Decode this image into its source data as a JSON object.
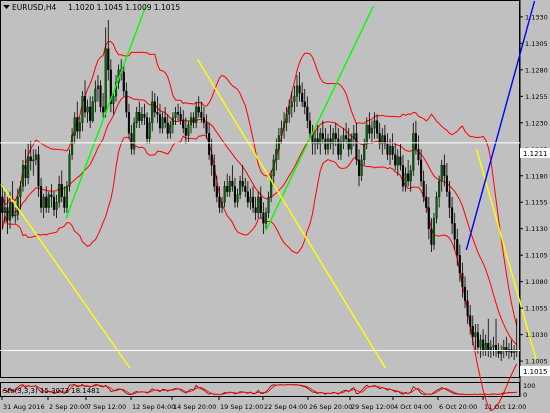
{
  "header": {
    "symbol": "EURUSD,H4",
    "ohlc": "1.1020 1.1045 1.1009 1.1015"
  },
  "sub_window": {
    "label": "Sto(3,3,3) 15.3073 18.1481",
    "ticks": [
      "100",
      "0"
    ]
  },
  "price_labels": {
    "hline": "1.1211",
    "bid": "1.1015"
  },
  "colors": {
    "background": "#c0c0c0",
    "bull_candle": "#006400",
    "bear_candle": "#000000",
    "bands": "#ff0000",
    "trend_up": "#00ff00",
    "trend_down": "#ffff00",
    "trend_blue": "#0000ff",
    "hline": "#ffffff",
    "oscillator": "#8b0000"
  },
  "chart_data": {
    "type": "candlestick",
    "symbol": "EURUSD",
    "timeframe": "H4",
    "ylim": [
      1.099,
      1.1345
    ],
    "y_ticks": [
      "1.1005",
      "1.1030",
      "1.1055",
      "1.1080",
      "1.1105",
      "1.1130",
      "1.1155",
      "1.1180",
      "1.1205",
      "1.1230",
      "1.1255",
      "1.1280",
      "1.1305",
      "1.1330"
    ],
    "x_ticks": [
      "31 Aug 2016",
      "2 Sep 20:00",
      "7 Sep 12:00",
      "12 Sep 04:00",
      "14 Sep 20:00",
      "19 Sep 12:00",
      "22 Sep 04:00",
      "26 Sep 20:00",
      "29 Sep 12:00",
      "4 Oct 04:00",
      "6 Oct 20:00",
      "11 Oct 12:00"
    ],
    "x_count": 210,
    "hline_level": 1.1211,
    "bid_level": 1.1015,
    "candles": [
      [
        1.116,
        1.1172,
        1.113,
        1.1145
      ],
      [
        1.1145,
        1.1165,
        1.1135,
        1.115
      ],
      [
        1.115,
        1.116,
        1.1125,
        1.1138
      ],
      [
        1.1138,
        1.1165,
        1.113,
        1.1155
      ],
      [
        1.1155,
        1.1175,
        1.114,
        1.1142
      ],
      [
        1.1142,
        1.115,
        1.1135,
        1.1143
      ],
      [
        1.1143,
        1.1168,
        1.1138,
        1.116
      ],
      [
        1.116,
        1.1175,
        1.1148,
        1.117
      ],
      [
        1.117,
        1.1195,
        1.1165,
        1.119
      ],
      [
        1.119,
        1.1205,
        1.117,
        1.1178
      ],
      [
        1.1178,
        1.121,
        1.1172,
        1.1198
      ],
      [
        1.1198,
        1.1213,
        1.1185,
        1.1194
      ],
      [
        1.1194,
        1.1205,
        1.118,
        1.1195
      ],
      [
        1.1195,
        1.1205,
        1.119,
        1.12
      ],
      [
        1.12,
        1.1208,
        1.116,
        1.117
      ],
      [
        1.117,
        1.1178,
        1.1145,
        1.115
      ],
      [
        1.115,
        1.1163,
        1.114,
        1.116
      ],
      [
        1.116,
        1.117,
        1.1145,
        1.115
      ],
      [
        1.115,
        1.1165,
        1.1145,
        1.1162
      ],
      [
        1.1162,
        1.1172,
        1.115,
        1.116
      ],
      [
        1.116,
        1.1165,
        1.1142,
        1.1148
      ],
      [
        1.1148,
        1.1162,
        1.114,
        1.1155
      ],
      [
        1.1155,
        1.118,
        1.115,
        1.1172
      ],
      [
        1.1172,
        1.1185,
        1.1155,
        1.116
      ],
      [
        1.116,
        1.117,
        1.1145,
        1.115
      ],
      [
        1.115,
        1.1175,
        1.1145,
        1.117
      ],
      [
        1.117,
        1.1205,
        1.1165,
        1.12
      ],
      [
        1.12,
        1.1225,
        1.1195,
        1.1218
      ],
      [
        1.1218,
        1.124,
        1.121,
        1.1235
      ],
      [
        1.1235,
        1.125,
        1.1215,
        1.1222
      ],
      [
        1.1222,
        1.1235,
        1.1215,
        1.123
      ],
      [
        1.123,
        1.126,
        1.1222,
        1.1255
      ],
      [
        1.1255,
        1.127,
        1.1235,
        1.124
      ],
      [
        1.124,
        1.1252,
        1.123,
        1.1245
      ],
      [
        1.1245,
        1.1255,
        1.1225,
        1.1232
      ],
      [
        1.1232,
        1.1255,
        1.123,
        1.125
      ],
      [
        1.125,
        1.127,
        1.124,
        1.1262
      ],
      [
        1.1262,
        1.1275,
        1.125,
        1.1265
      ],
      [
        1.1265,
        1.127,
        1.124,
        1.1245
      ],
      [
        1.1245,
        1.1258,
        1.1235,
        1.124
      ],
      [
        1.124,
        1.132,
        1.1235,
        1.13
      ],
      [
        1.13,
        1.1327,
        1.127,
        1.128
      ],
      [
        1.128,
        1.129,
        1.124,
        1.1248
      ],
      [
        1.1248,
        1.126,
        1.1238,
        1.1255
      ],
      [
        1.1255,
        1.1275,
        1.125,
        1.1268
      ],
      [
        1.1268,
        1.1285,
        1.1262,
        1.128
      ],
      [
        1.128,
        1.129,
        1.127,
        1.1278
      ],
      [
        1.1278,
        1.1285,
        1.1255,
        1.126
      ],
      [
        1.126,
        1.1268,
        1.1235,
        1.124
      ],
      [
        1.124,
        1.1248,
        1.1215,
        1.122
      ],
      [
        1.122,
        1.1228,
        1.12,
        1.1205
      ],
      [
        1.1205,
        1.1235,
        1.12,
        1.123
      ],
      [
        1.123,
        1.1245,
        1.1225,
        1.124
      ],
      [
        1.124,
        1.125,
        1.1225,
        1.1232
      ],
      [
        1.1232,
        1.1245,
        1.1228,
        1.1238
      ],
      [
        1.1238,
        1.1248,
        1.1228,
        1.1235
      ],
      [
        1.1235,
        1.124,
        1.121,
        1.1215
      ],
      [
        1.1215,
        1.1235,
        1.121,
        1.123
      ],
      [
        1.123,
        1.126,
        1.1222,
        1.125
      ],
      [
        1.125,
        1.1258,
        1.1235,
        1.124
      ],
      [
        1.124,
        1.1255,
        1.123,
        1.1238
      ],
      [
        1.1238,
        1.1248,
        1.122,
        1.1225
      ],
      [
        1.1225,
        1.124,
        1.122,
        1.1235
      ],
      [
        1.1235,
        1.1245,
        1.1225,
        1.123
      ],
      [
        1.123,
        1.1238,
        1.1215,
        1.122
      ],
      [
        1.122,
        1.1232,
        1.1215,
        1.1228
      ],
      [
        1.1228,
        1.124,
        1.122,
        1.1235
      ],
      [
        1.1235,
        1.1245,
        1.1228,
        1.124
      ],
      [
        1.124,
        1.1248,
        1.1232,
        1.1238
      ],
      [
        1.1238,
        1.1245,
        1.1228,
        1.1232
      ],
      [
        1.1232,
        1.1242,
        1.122,
        1.1225
      ],
      [
        1.1225,
        1.1235,
        1.121,
        1.1218
      ],
      [
        1.1218,
        1.1232,
        1.1212,
        1.1228
      ],
      [
        1.1228,
        1.124,
        1.122,
        1.1235
      ],
      [
        1.1235,
        1.124,
        1.1225,
        1.123
      ],
      [
        1.123,
        1.125,
        1.1225,
        1.1245
      ],
      [
        1.1245,
        1.1255,
        1.1235,
        1.124
      ],
      [
        1.124,
        1.125,
        1.123,
        1.1235
      ],
      [
        1.1235,
        1.1245,
        1.1225,
        1.123
      ],
      [
        1.123,
        1.1238,
        1.1215,
        1.122
      ],
      [
        1.122,
        1.123,
        1.1195,
        1.12
      ],
      [
        1.12,
        1.1215,
        1.118,
        1.119
      ],
      [
        1.119,
        1.12,
        1.1165,
        1.117
      ],
      [
        1.117,
        1.118,
        1.1155,
        1.116
      ],
      [
        1.116,
        1.117,
        1.1145,
        1.115
      ],
      [
        1.115,
        1.116,
        1.1145,
        1.1155
      ],
      [
        1.1155,
        1.1175,
        1.115,
        1.117
      ],
      [
        1.117,
        1.1182,
        1.116,
        1.1165
      ],
      [
        1.1165,
        1.118,
        1.116,
        1.1175
      ],
      [
        1.1175,
        1.119,
        1.1165,
        1.117
      ],
      [
        1.117,
        1.1178,
        1.115,
        1.1155
      ],
      [
        1.1155,
        1.1168,
        1.115,
        1.1162
      ],
      [
        1.1162,
        1.118,
        1.1158,
        1.1175
      ],
      [
        1.1175,
        1.119,
        1.1165,
        1.117
      ],
      [
        1.117,
        1.1178,
        1.116,
        1.1165
      ],
      [
        1.1165,
        1.1175,
        1.115,
        1.1155
      ],
      [
        1.1155,
        1.1168,
        1.1148,
        1.116
      ],
      [
        1.116,
        1.117,
        1.1145,
        1.115
      ],
      [
        1.115,
        1.116,
        1.1138,
        1.1145
      ],
      [
        1.1145,
        1.1165,
        1.114,
        1.116
      ],
      [
        1.116,
        1.117,
        1.114,
        1.1145
      ],
      [
        1.1145,
        1.1155,
        1.1125,
        1.1135
      ],
      [
        1.1135,
        1.115,
        1.113,
        1.1145
      ],
      [
        1.1145,
        1.1165,
        1.114,
        1.116
      ],
      [
        1.116,
        1.1185,
        1.1155,
        1.118
      ],
      [
        1.118,
        1.12,
        1.117,
        1.1195
      ],
      [
        1.1195,
        1.1215,
        1.1185,
        1.1205
      ],
      [
        1.1205,
        1.1225,
        1.1195,
        1.1218
      ],
      [
        1.1218,
        1.1232,
        1.121,
        1.1225
      ],
      [
        1.1225,
        1.124,
        1.1215,
        1.123
      ],
      [
        1.123,
        1.1245,
        1.1222,
        1.1238
      ],
      [
        1.1238,
        1.1252,
        1.123,
        1.1245
      ],
      [
        1.1245,
        1.126,
        1.1235,
        1.125
      ],
      [
        1.125,
        1.1265,
        1.124,
        1.1255
      ],
      [
        1.1255,
        1.1275,
        1.1245,
        1.1265
      ],
      [
        1.1265,
        1.1278,
        1.125,
        1.1258
      ],
      [
        1.1258,
        1.1268,
        1.1245,
        1.125
      ],
      [
        1.125,
        1.1262,
        1.1238,
        1.1245
      ],
      [
        1.1245,
        1.1255,
        1.1225,
        1.1232
      ],
      [
        1.1232,
        1.124,
        1.1215,
        1.122
      ],
      [
        1.122,
        1.1228,
        1.12,
        1.121
      ],
      [
        1.121,
        1.1222,
        1.12,
        1.1215
      ],
      [
        1.1215,
        1.1228,
        1.1205,
        1.121
      ],
      [
        1.121,
        1.1225,
        1.12,
        1.122
      ],
      [
        1.122,
        1.1232,
        1.121,
        1.1215
      ],
      [
        1.1215,
        1.1225,
        1.12,
        1.1205
      ],
      [
        1.1205,
        1.122,
        1.12,
        1.1215
      ],
      [
        1.1215,
        1.1228,
        1.1205,
        1.121
      ],
      [
        1.121,
        1.1225,
        1.12,
        1.122
      ],
      [
        1.122,
        1.123,
        1.1208,
        1.1215
      ],
      [
        1.1215,
        1.1225,
        1.1195,
        1.12
      ],
      [
        1.12,
        1.1218,
        1.1195,
        1.1212
      ],
      [
        1.1212,
        1.1225,
        1.1205,
        1.1218
      ],
      [
        1.1218,
        1.123,
        1.121,
        1.1215
      ],
      [
        1.1215,
        1.1225,
        1.1198,
        1.1205
      ],
      [
        1.1205,
        1.122,
        1.12,
        1.1215
      ],
      [
        1.1215,
        1.1228,
        1.1208,
        1.122
      ],
      [
        1.122,
        1.123,
        1.119,
        1.1195
      ],
      [
        1.1195,
        1.1205,
        1.117,
        1.118
      ],
      [
        1.118,
        1.12,
        1.1175,
        1.1195
      ],
      [
        1.1195,
        1.1215,
        1.119,
        1.121
      ],
      [
        1.121,
        1.1235,
        1.1205,
        1.1228
      ],
      [
        1.1228,
        1.124,
        1.1215,
        1.122
      ],
      [
        1.122,
        1.1232,
        1.121,
        1.1225
      ],
      [
        1.1225,
        1.124,
        1.1215,
        1.1232
      ],
      [
        1.1232,
        1.1238,
        1.1215,
        1.122
      ],
      [
        1.122,
        1.123,
        1.1205,
        1.121
      ],
      [
        1.121,
        1.1225,
        1.12,
        1.1218
      ],
      [
        1.1218,
        1.1228,
        1.1205,
        1.121
      ],
      [
        1.121,
        1.122,
        1.1195,
        1.12
      ],
      [
        1.12,
        1.1215,
        1.119,
        1.1208
      ],
      [
        1.1208,
        1.122,
        1.1195,
        1.12
      ],
      [
        1.12,
        1.1212,
        1.1185,
        1.119
      ],
      [
        1.119,
        1.1205,
        1.118,
        1.1198
      ],
      [
        1.1198,
        1.121,
        1.1185,
        1.119
      ],
      [
        1.119,
        1.12,
        1.1165,
        1.117
      ],
      [
        1.117,
        1.1188,
        1.1165,
        1.1182
      ],
      [
        1.1182,
        1.1195,
        1.117,
        1.1175
      ],
      [
        1.1175,
        1.119,
        1.1165,
        1.1185
      ],
      [
        1.1185,
        1.123,
        1.118,
        1.122
      ],
      [
        1.122,
        1.1232,
        1.12,
        1.1205
      ],
      [
        1.1205,
        1.1218,
        1.119,
        1.1195
      ],
      [
        1.1195,
        1.1205,
        1.117,
        1.1175
      ],
      [
        1.1175,
        1.1185,
        1.1155,
        1.116
      ],
      [
        1.116,
        1.1172,
        1.1145,
        1.115
      ],
      [
        1.115,
        1.116,
        1.112,
        1.113
      ],
      [
        1.113,
        1.114,
        1.1108,
        1.1115
      ],
      [
        1.1115,
        1.1145,
        1.111,
        1.114
      ],
      [
        1.114,
        1.1165,
        1.1135,
        1.116
      ],
      [
        1.116,
        1.118,
        1.115,
        1.1175
      ],
      [
        1.1175,
        1.1195,
        1.1165,
        1.119
      ],
      [
        1.119,
        1.12,
        1.117,
        1.118
      ],
      [
        1.118,
        1.1192,
        1.116,
        1.1165
      ],
      [
        1.1165,
        1.1175,
        1.114,
        1.115
      ],
      [
        1.115,
        1.116,
        1.1125,
        1.1135
      ],
      [
        1.1135,
        1.1145,
        1.111,
        1.112
      ],
      [
        1.112,
        1.113,
        1.1095,
        1.1105
      ],
      [
        1.1105,
        1.1115,
        1.108,
        1.1088
      ],
      [
        1.1088,
        1.1098,
        1.1065,
        1.1075
      ],
      [
        1.1075,
        1.1085,
        1.1055,
        1.1062
      ],
      [
        1.1062,
        1.1072,
        1.104,
        1.1048
      ],
      [
        1.1048,
        1.1058,
        1.103,
        1.1038
      ],
      [
        1.1038,
        1.1048,
        1.102,
        1.1028
      ],
      [
        1.1028,
        1.104,
        1.1015,
        1.1032
      ],
      [
        1.1032,
        1.104,
        1.1012,
        1.1018
      ],
      [
        1.1018,
        1.103,
        1.1008,
        1.1025
      ],
      [
        1.1025,
        1.1035,
        1.101,
        1.1015
      ],
      [
        1.1015,
        1.103,
        1.101,
        1.1022
      ],
      [
        1.1022,
        1.1045,
        1.1009,
        1.1015
      ],
      [
        1.1015,
        1.1025,
        1.1008,
        1.1018
      ],
      [
        1.1018,
        1.1028,
        1.101,
        1.102
      ],
      [
        1.102,
        1.1045,
        1.1009,
        1.1015
      ],
      [
        1.1015,
        1.1022,
        1.1008,
        1.1012
      ],
      [
        1.1012,
        1.102,
        1.1005,
        1.1015
      ],
      [
        1.1015,
        1.1025,
        1.1008,
        1.1018
      ],
      [
        1.1018,
        1.1028,
        1.101,
        1.1014
      ],
      [
        1.1014,
        1.1022,
        1.1007,
        1.1016
      ],
      [
        1.1016,
        1.1025,
        1.1009,
        1.1013
      ],
      [
        1.1013,
        1.102,
        1.1006,
        1.1015
      ],
      [
        1.1015,
        1.1045,
        1.1009,
        1.1015
      ]
    ],
    "trendlines": [
      {
        "color": "trend_up",
        "from": [
          63,
          1.114
        ],
        "to": [
          140,
          1.134
        ]
      },
      {
        "color": "trend_up",
        "from": [
          256,
          1.1128
        ],
        "to": [
          360,
          1.134
        ]
      },
      {
        "color": "trend_down",
        "from": [
          0,
          1.1172
        ],
        "to": [
          125,
          1.0998
        ]
      },
      {
        "color": "trend_down",
        "from": [
          190,
          1.129
        ],
        "to": [
          372,
          1.0998
        ]
      },
      {
        "color": "trend_down",
        "from": [
          460,
          1.1205
        ],
        "to": [
          518,
          1.1005
        ]
      },
      {
        "color": "trend_blue",
        "from": [
          450,
          1.111
        ],
        "to": [
          516,
          1.1345
        ]
      }
    ]
  }
}
